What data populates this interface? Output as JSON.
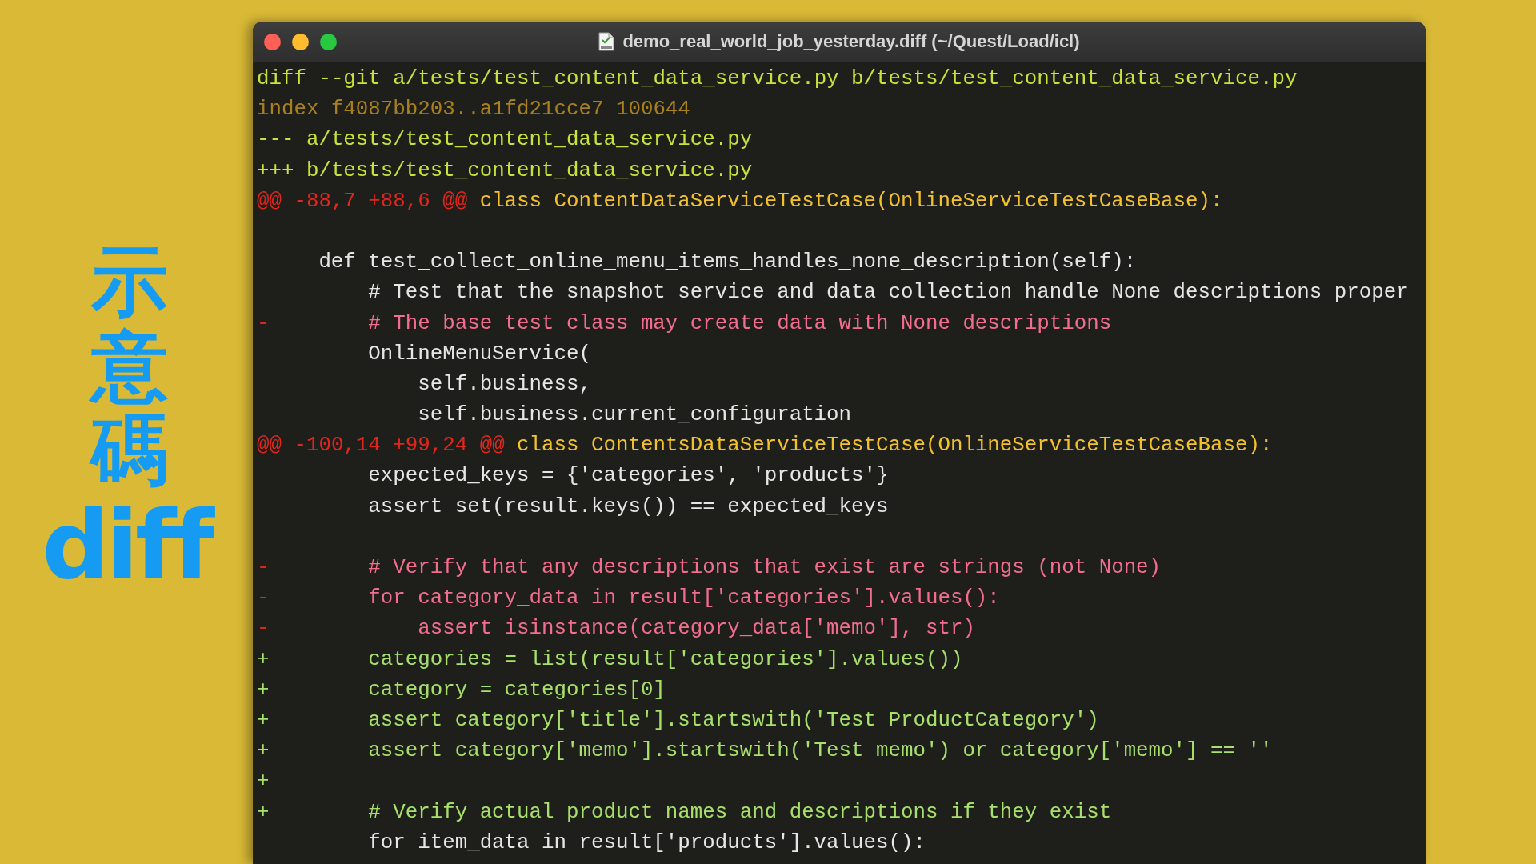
{
  "side_caption": {
    "vertical_text": "示意碼",
    "word": "diff"
  },
  "window": {
    "title": "demo_real_world_job_yesterday.diff (~/Quest/Load/icl)"
  },
  "lines": [
    {
      "kind": "header",
      "text": "diff --git a/tests/test_content_data_service.py b/tests/test_content_data_service.py"
    },
    {
      "kind": "index",
      "text": "index f4087bb203..a1fd21cce7 100644"
    },
    {
      "kind": "header",
      "text": "--- a/tests/test_content_data_service.py"
    },
    {
      "kind": "header",
      "text": "+++ b/tests/test_content_data_service.py"
    },
    {
      "kind": "hunk",
      "range": "@@ -88,7 +88,6 @@",
      "text": "class ContentDataServiceTestCase(OnlineServiceTestCaseBase):"
    },
    {
      "kind": "blank"
    },
    {
      "kind": "context",
      "text": "    def test_collect_online_menu_items_handles_none_description(self):"
    },
    {
      "kind": "context",
      "text": "        # Test that the snapshot service and data collection handle None descriptions proper"
    },
    {
      "kind": "removed",
      "sign": "-",
      "text": "        # The base test class may create data with None descriptions"
    },
    {
      "kind": "context",
      "text": "        OnlineMenuService("
    },
    {
      "kind": "context",
      "text": "            self.business,"
    },
    {
      "kind": "context",
      "text": "            self.business.current_configuration"
    },
    {
      "kind": "hunk",
      "range": "@@ -100,14 +99,24 @@",
      "text": "class ContentsDataServiceTestCase(OnlineServiceTestCaseBase):"
    },
    {
      "kind": "context",
      "text": "        expected_keys = {'categories', 'products'}"
    },
    {
      "kind": "context",
      "text": "        assert set(result.keys()) == expected_keys"
    },
    {
      "kind": "blank"
    },
    {
      "kind": "removed",
      "sign": "-",
      "text": "        # Verify that any descriptions that exist are strings (not None)"
    },
    {
      "kind": "removed",
      "sign": "-",
      "text": "        for category_data in result['categories'].values():"
    },
    {
      "kind": "removed",
      "sign": "-",
      "text": "            assert isinstance(category_data['memo'], str)"
    },
    {
      "kind": "added",
      "sign": "+",
      "text": "        categories = list(result['categories'].values())"
    },
    {
      "kind": "added",
      "sign": "+",
      "text": "        category = categories[0]"
    },
    {
      "kind": "added",
      "sign": "+",
      "text": "        assert category['title'].startswith('Test ProductCategory')"
    },
    {
      "kind": "added",
      "sign": "+",
      "text": "        assert category['memo'].startswith('Test memo') or category['memo'] == ''"
    },
    {
      "kind": "added",
      "sign": "+"
    },
    {
      "kind": "added",
      "sign": "+",
      "text": "        # Verify actual product names and descriptions if they exist"
    },
    {
      "kind": "context",
      "text": "        for item_data in result['products'].values():"
    }
  ]
}
